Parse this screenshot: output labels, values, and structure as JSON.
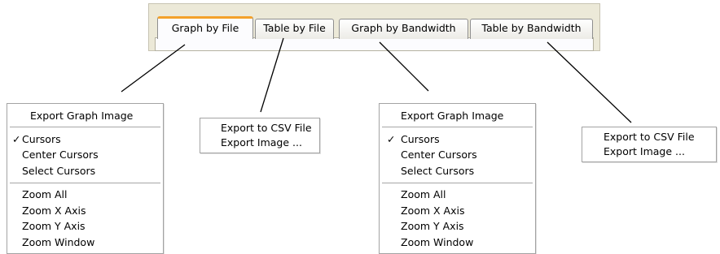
{
  "tabs": [
    {
      "label": "Graph by File",
      "active": true
    },
    {
      "label": "Table by File",
      "active": false
    },
    {
      "label": "Graph by Bandwidth",
      "active": false
    },
    {
      "label": "Table by Bandwidth",
      "active": false
    }
  ],
  "graph_menu_1": {
    "export_graph_image": "Export Graph Image",
    "check_mark": "✓",
    "cursors": "Cursors",
    "center_cursors": "Center Cursors",
    "select_cursors": "Select Cursors",
    "zoom_all": "Zoom All",
    "zoom_x_axis": "Zoom X Axis",
    "zoom_y_axis": "Zoom Y Axis",
    "zoom_window": "Zoom Window"
  },
  "table_menu_1": {
    "export_csv": "Export to CSV File",
    "export_image": "Export Image ..."
  },
  "graph_menu_2": {
    "export_graph_image": "Export Graph Image",
    "check_mark": "✓",
    "cursors": "Cursors",
    "center_cursors": "Center Cursors",
    "select_cursors": "Select Cursors",
    "zoom_all": "Zoom All",
    "zoom_x_axis": "Zoom X Axis",
    "zoom_y_axis": "Zoom Y Axis",
    "zoom_window": "Zoom Window"
  },
  "table_menu_2": {
    "export_csv": "Export to CSV File",
    "export_image": "Export Image ..."
  },
  "colors": {
    "tab_strip_bg": "#ece9d8",
    "active_tab_accent": "#f3a12b",
    "menu_border": "#a3a3a3"
  }
}
